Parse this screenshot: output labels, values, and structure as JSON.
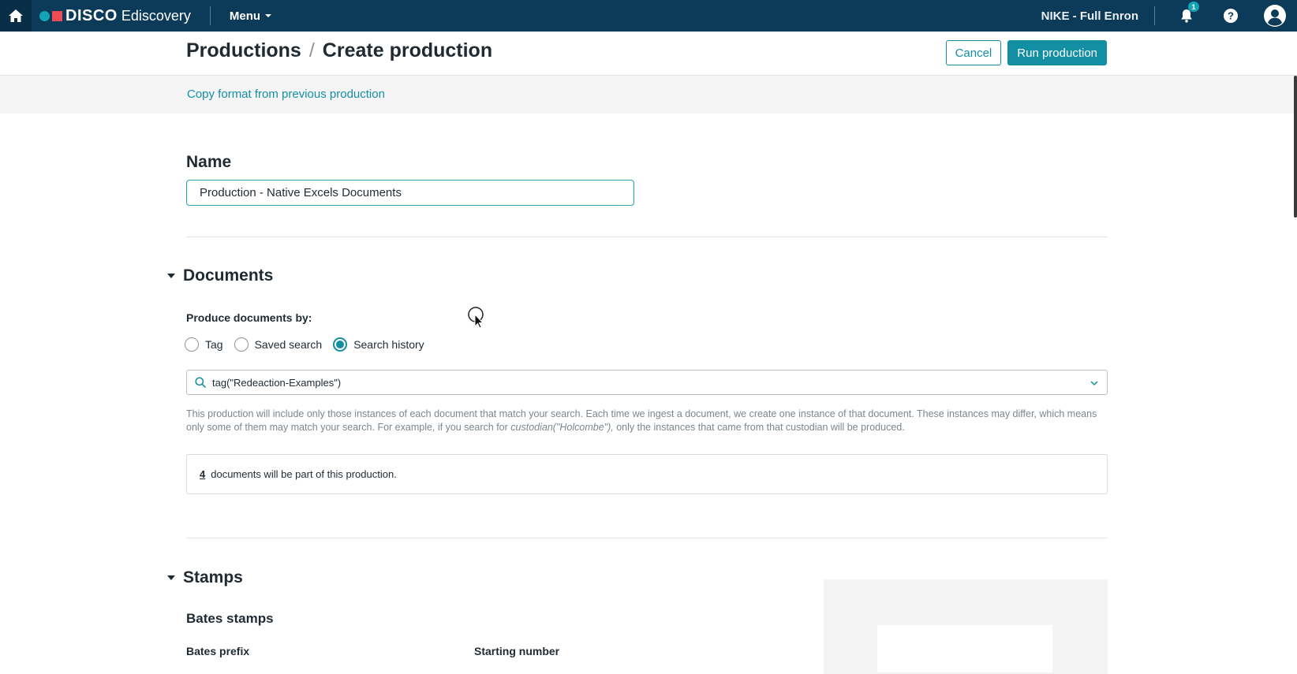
{
  "topbar": {
    "brand_name": "DISCO",
    "brand_suffix": "Ediscovery",
    "menu_label": "Menu",
    "matter_name": "NIKE - Full Enron",
    "notification_count": "1"
  },
  "header": {
    "crumb_parent": "Productions",
    "crumb_separator": "/",
    "crumb_current": "Create production",
    "cancel_label": "Cancel",
    "run_label": "Run production"
  },
  "copy_format_link": "Copy format from previous production",
  "name_section": {
    "label": "Name",
    "value": "Production - Native Excels Documents"
  },
  "documents_section": {
    "title": "Documents",
    "produce_label": "Produce documents by:",
    "options": [
      {
        "label": "Tag",
        "checked": false
      },
      {
        "label": "Saved search",
        "checked": false
      },
      {
        "label": "Search history",
        "checked": true
      }
    ],
    "search_query": "tag(\"Redeaction-Examples\")",
    "help_text_1": "This production will include only those instances of each document that match your search. Each time we ingest a document, we create one instance of that document. These instances may differ, which means only some of them may match your search. For example, if you search for ",
    "help_text_example": "custodian(\"Holcombe\"),",
    "help_text_2": " only the instances that came from that custodian will be produced.",
    "doc_count": "4",
    "doc_count_text": "documents will be part of this production."
  },
  "stamps_section": {
    "title": "Stamps",
    "bates_title": "Bates stamps",
    "bates_prefix_label": "Bates prefix",
    "starting_number_label": "Starting number"
  },
  "colors": {
    "topbar": "#0c3b5a",
    "accent": "#138fa3",
    "brand_dot": "#13a3b4",
    "brand_square": "#ef4b54"
  }
}
